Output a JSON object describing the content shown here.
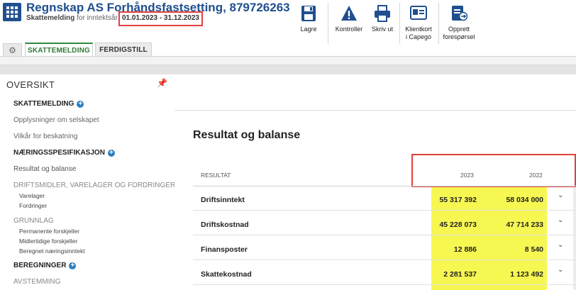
{
  "header": {
    "company_title": "Regnskap AS Forhåndsfastsetting, 879726263",
    "subtitle_prefix": "Skattemelding",
    "subtitle_middle": "for inntektsår",
    "period": "01.01.2023 - 31.12.2023"
  },
  "toolbar": {
    "save": "Lagre",
    "check": "Kontroller",
    "print": "Skriv ut",
    "client_card_1": "Klientkort",
    "client_card_2": "i Capego",
    "create_request_1": "Opprett",
    "create_request_2": "forespørsel"
  },
  "tabs": {
    "active": "SKATTEMELDING",
    "inactive": "FERDIGSTILL"
  },
  "sidebar": {
    "title": "OVERSIKT",
    "skattemelding": "SKATTEMELDING",
    "opplysninger": "Opplysninger om selskapet",
    "vilkar": "Vilkår for beskatning",
    "naeringsspesifikasjon": "NÆRINGSSPESIFIKASJON",
    "resultat_balanse": "Resultat og balanse",
    "driftsmidler": "DRIFTSMIDLER, VARELAGER OG FORDRINGER",
    "varelager": "Varelager",
    "fordringer": "Fordringer",
    "grunnlag": "GRUNNLAG",
    "permanente": "Permanente forskjeller",
    "midlertidige": "Midlertidige forskjeller",
    "beregnet": "Beregnet næringsinntekt",
    "beregninger": "BEREGNINGER",
    "avstemming": "AVSTEMMING"
  },
  "main": {
    "title": "Resultat og balanse",
    "col_label": "RESULTAT",
    "col_year1": "2023",
    "col_year2": "2022",
    "rows": [
      {
        "label": "Driftsinntekt",
        "v2023": "55 317 392",
        "v2022": "58 034 000"
      },
      {
        "label": "Driftskostnad",
        "v2023": "45 228 073",
        "v2022": "47 714 233"
      },
      {
        "label": "Finansposter",
        "v2023": "12 886",
        "v2022": "8 540"
      },
      {
        "label": "Skattekostnad",
        "v2023": "2 281 537",
        "v2022": "1 123 492"
      }
    ]
  },
  "colors": {
    "brand_blue": "#1f4f8f",
    "tab_green": "#2e7a35",
    "highlight_yellow": "#f7f752",
    "annotation_red": "#e0403c"
  },
  "icons": [
    "app-grid-icon",
    "save-icon",
    "warning-icon",
    "print-icon",
    "client-card-icon",
    "create-request-icon",
    "gear-icon",
    "pin-icon",
    "plus-icon",
    "chevron-down-icon"
  ]
}
